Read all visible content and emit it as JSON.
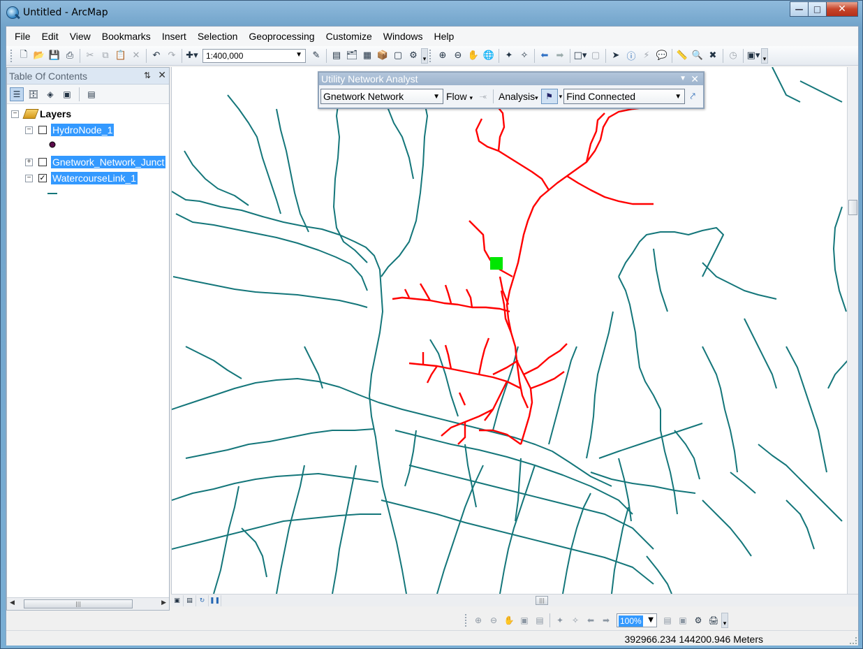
{
  "window": {
    "title": "Untitled - ArcMap"
  },
  "menu": [
    "File",
    "Edit",
    "View",
    "Bookmarks",
    "Insert",
    "Selection",
    "Geoprocessing",
    "Customize",
    "Windows",
    "Help"
  ],
  "toolbar": {
    "scale": "1:400,000"
  },
  "toc": {
    "title": "Table Of Contents",
    "root": "Layers",
    "layers": [
      {
        "name": "HydroNode_1",
        "checked": false,
        "expanded": true
      },
      {
        "name": "Gnetwork_Network_Junct",
        "checked": false,
        "expanded": false
      },
      {
        "name": "WatercourseLink_1",
        "checked": true,
        "expanded": true
      }
    ]
  },
  "una": {
    "title": "Utility Network Analyst",
    "network": "Gnetwork Network",
    "flow": "Flow",
    "analysis": "Analysis",
    "task": "Find Connected"
  },
  "bottom": {
    "zoom": "100%"
  },
  "status": {
    "coordinates": "392966.234  144200.946 Meters"
  },
  "colors": {
    "network_lines": "#14767a",
    "traced": "#ff0000",
    "flag": "#00e600",
    "selection": "#3399ff"
  }
}
